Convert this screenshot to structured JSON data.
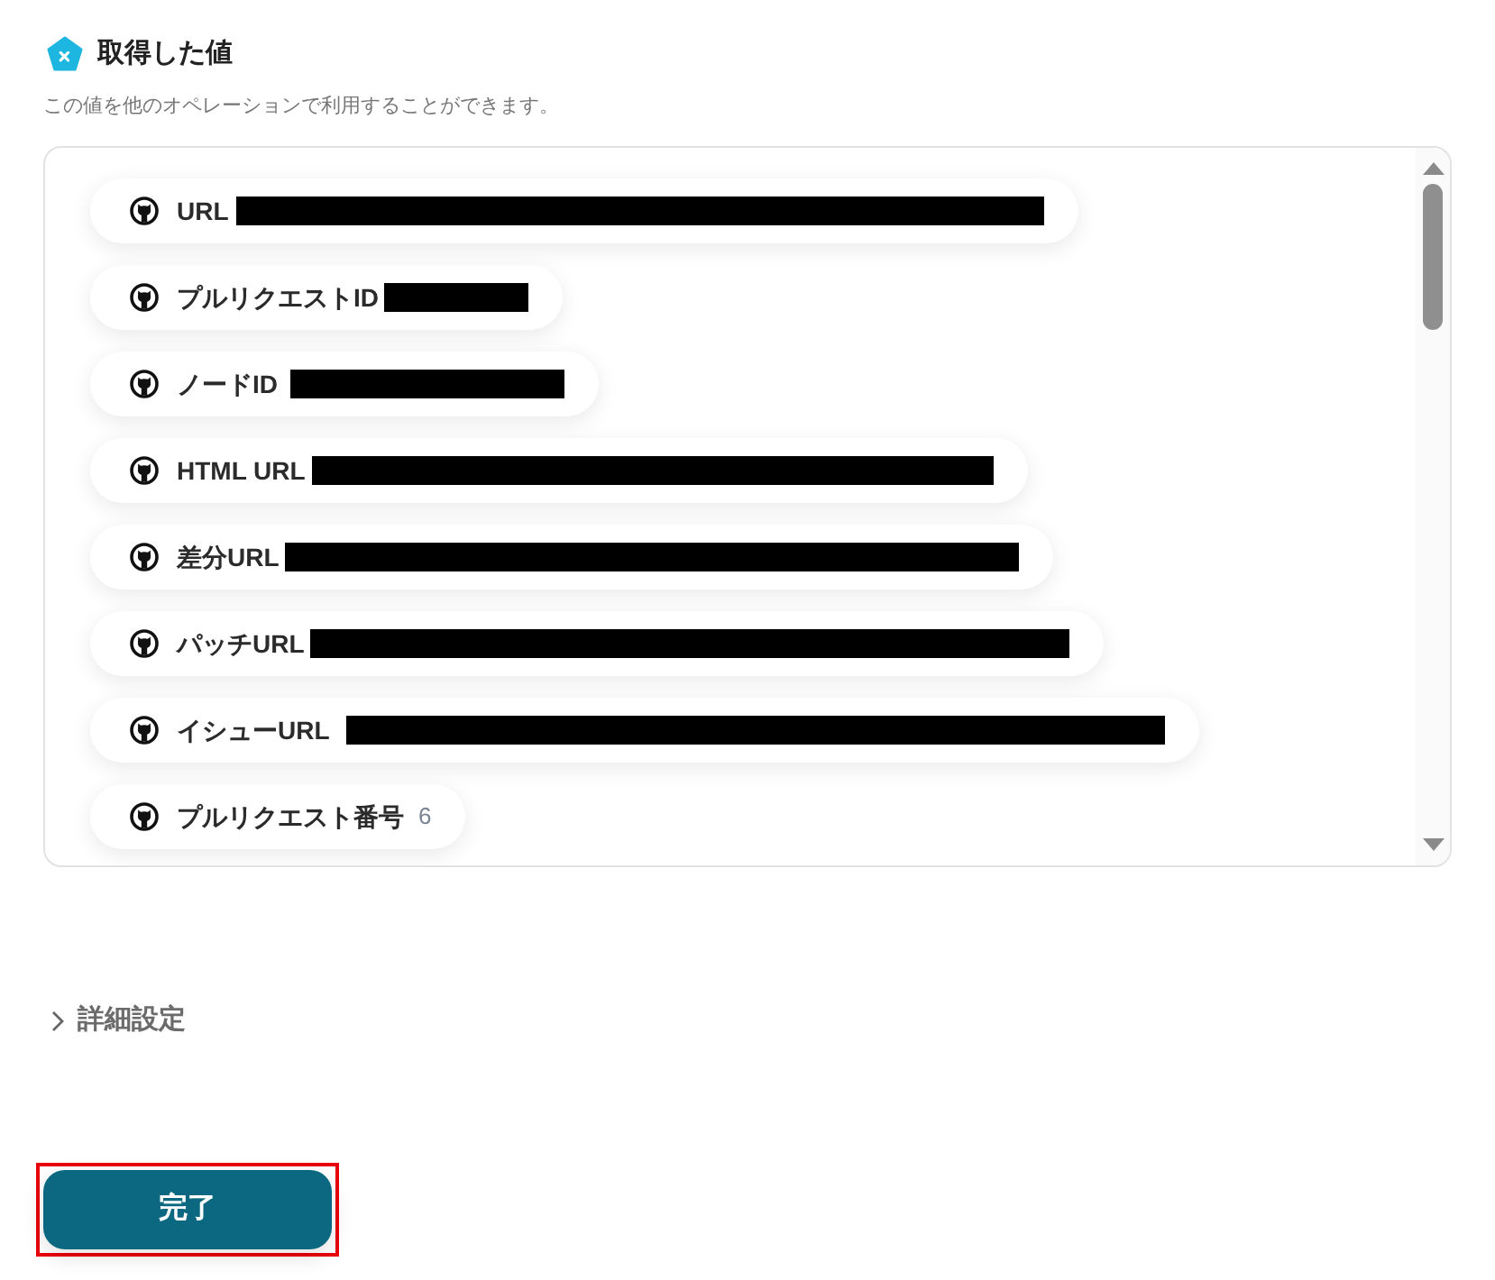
{
  "header": {
    "title": "取得した値",
    "description": "この値を他のオペレーションで利用することができます。"
  },
  "values": [
    {
      "label": "URL",
      "redacted": true
    },
    {
      "label": "プルリクエストID",
      "redacted": true
    },
    {
      "label": "ノードID",
      "redacted": true
    },
    {
      "label": "HTML URL",
      "redacted": true
    },
    {
      "label": "差分URL",
      "redacted": true
    },
    {
      "label": "パッチURL",
      "redacted": true
    },
    {
      "label": "イシューURL",
      "redacted": true
    },
    {
      "label": "プルリクエスト番号",
      "value": "6",
      "redacted": false
    }
  ],
  "advanced_settings": {
    "label": "詳細設定",
    "expanded": false
  },
  "done_button": {
    "label": "完了",
    "highlighted": true
  }
}
